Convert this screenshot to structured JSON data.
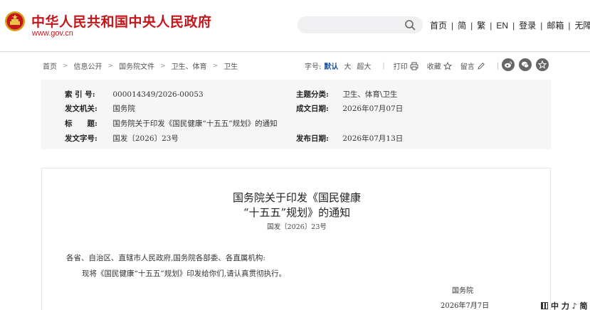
{
  "header": {
    "site_title": "中华人民共和国中央人民政府",
    "site_url": "www.gov.cn",
    "search": {
      "placeholder": "",
      "value": ""
    },
    "nav": [
      "首页",
      "简",
      "繁",
      "EN",
      "登录",
      "邮箱",
      "无障碍"
    ]
  },
  "breadcrumb": [
    "首页",
    "信息公开",
    "国务院文件",
    "卫生、体育",
    "卫生"
  ],
  "tools": {
    "font_size_label": "字号:",
    "font_sizes": [
      "默认",
      "大",
      "超大"
    ],
    "print": "打印",
    "favorite": "收藏",
    "comment": "留言"
  },
  "meta": {
    "index_label": "索 引 号:",
    "index_value": "000014349/2026-00053",
    "category_label": "主题分类:",
    "category_value": "卫生、体育\\卫生",
    "issuer_label": "发文机关:",
    "issuer_value": "国务院",
    "written_label": "成文日期:",
    "written_value": "2026年07月07日",
    "title_label": "标　　题:",
    "title_value": "国务院关于印发《国民健康“十五五”规划》的通知",
    "docno_label": "发文字号:",
    "docno_value": "国发〔2026〕23号",
    "published_label": "发布日期:",
    "published_value": "2026年07月13日"
  },
  "document": {
    "title_line1": "国务院关于印发《国民健康",
    "title_line2": "“十五五”规划》的通知",
    "doc_number": "国发〔2026〕23号",
    "salutation": "各省、自治区、直辖市人民政府,国务院各部委、各直属机构:",
    "body": "现将《国民健康“十五五”规划》印发给你们,请认真贯彻执行。",
    "signature": "国务院",
    "date": "2026年7月7日"
  },
  "float_tag": "中 力 ♪ 简",
  "colors": {
    "brand_red": "#c4161c",
    "link_blue": "#1a4f9c",
    "meta_bg": "#f6f6f6"
  }
}
